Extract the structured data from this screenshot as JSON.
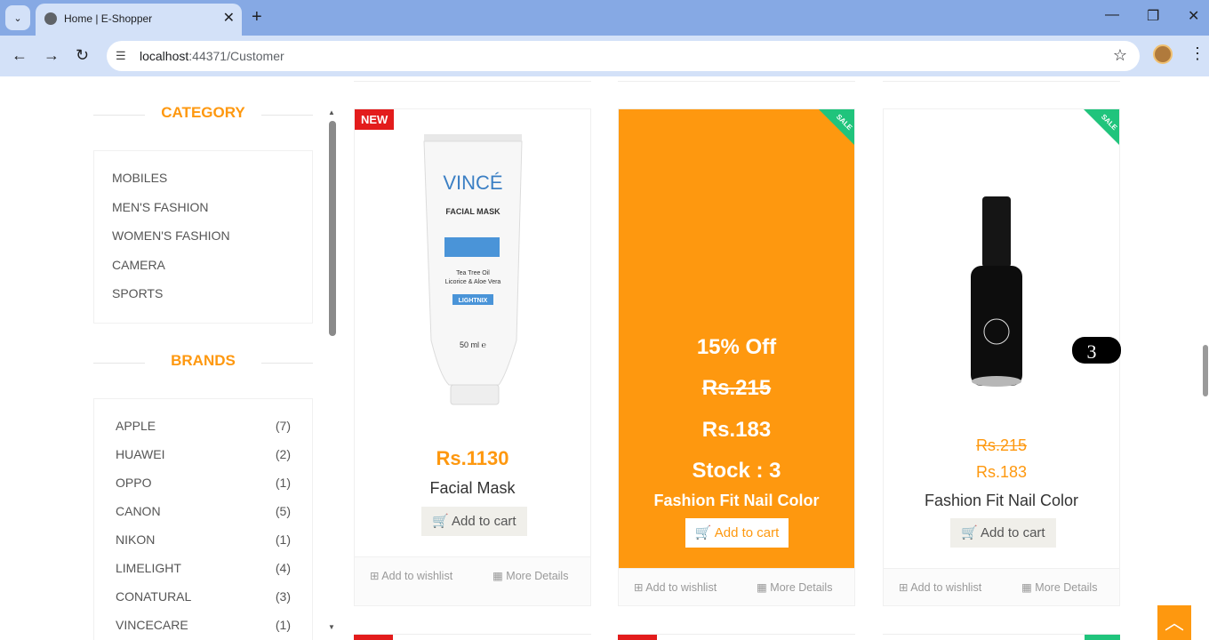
{
  "browser": {
    "tab_title": "Home | E-Shopper",
    "url_host": "localhost",
    "url_rest": ":44371/Customer"
  },
  "sidebar": {
    "category_title": "CATEGORY",
    "categories": [
      "MOBILES",
      "MEN'S FASHION",
      "WOMEN'S FASHION",
      "CAMERA",
      "SPORTS"
    ],
    "brands_title": "BRANDS",
    "brands": [
      {
        "name": "APPLE",
        "count": "(7)"
      },
      {
        "name": "HUAWEI",
        "count": "(2)"
      },
      {
        "name": "OPPO",
        "count": "(1)"
      },
      {
        "name": "CANON",
        "count": "(5)"
      },
      {
        "name": "NIKON",
        "count": "(1)"
      },
      {
        "name": "LIMELIGHT",
        "count": "(4)"
      },
      {
        "name": "CONATURAL",
        "count": "(3)"
      },
      {
        "name": "VINCECARE",
        "count": "(1)"
      }
    ]
  },
  "products": [
    {
      "badge": "NEW",
      "price": "Rs.1130",
      "name": "Facial Mask",
      "add_to_cart": "Add to cart",
      "wishlist": "Add to wishlist",
      "details": "More Details",
      "image_text": {
        "brand": "VINCÉ",
        "line1": "FACIAL MASK",
        "line2": "Tea Tree Oil",
        "line3": "Licorice & Aloe Vera",
        "line4": "LIGHTNIX",
        "line5": "50 ml ℮"
      }
    },
    {
      "badge": "SALE",
      "discount": "15% Off",
      "old_price": "Rs.215",
      "new_price": "Rs.183",
      "stock": "Stock : 3",
      "name": "Fashion Fit Nail Color",
      "add_to_cart": "Add to cart",
      "wishlist": "Add to wishlist",
      "details": "More Details"
    },
    {
      "badge": "SALE",
      "old_price": "Rs.215",
      "new_price": "Rs.183",
      "name": "Fashion Fit Nail Color",
      "add_to_cart": "Add to cart",
      "wishlist": "Add to wishlist",
      "details": "More Details",
      "image_text": {
        "shade": "3"
      }
    }
  ],
  "colors": {
    "accent": "#fe980f",
    "new_badge": "#e31c1c",
    "sale_ribbon": "#20c47c"
  }
}
